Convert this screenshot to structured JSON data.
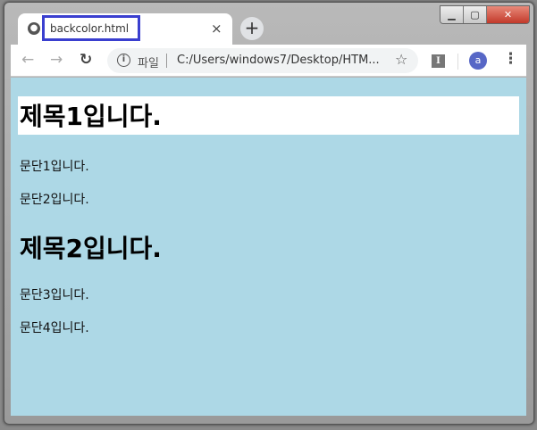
{
  "window": {
    "minimize": "▁",
    "maximize": "▢",
    "close": "✕"
  },
  "tab": {
    "title": "backcolor.html",
    "close": "×",
    "new_tab": "+"
  },
  "toolbar": {
    "back": "←",
    "forward": "→",
    "reload": "↻",
    "info": "i",
    "scheme_label": "파일",
    "url": "C:/Users/windows7/Desktop/HTM...",
    "star": "☆",
    "extension": "I",
    "avatar": "a",
    "menu": "⋮"
  },
  "page": {
    "background_color": "#add8e6",
    "heading1": "제목1입니다.",
    "para1": "문단1입니다.",
    "para2": "문단2입니다.",
    "heading2": "제목2입니다.",
    "para3": "문단3입니다.",
    "para4": "문단4입니다."
  }
}
